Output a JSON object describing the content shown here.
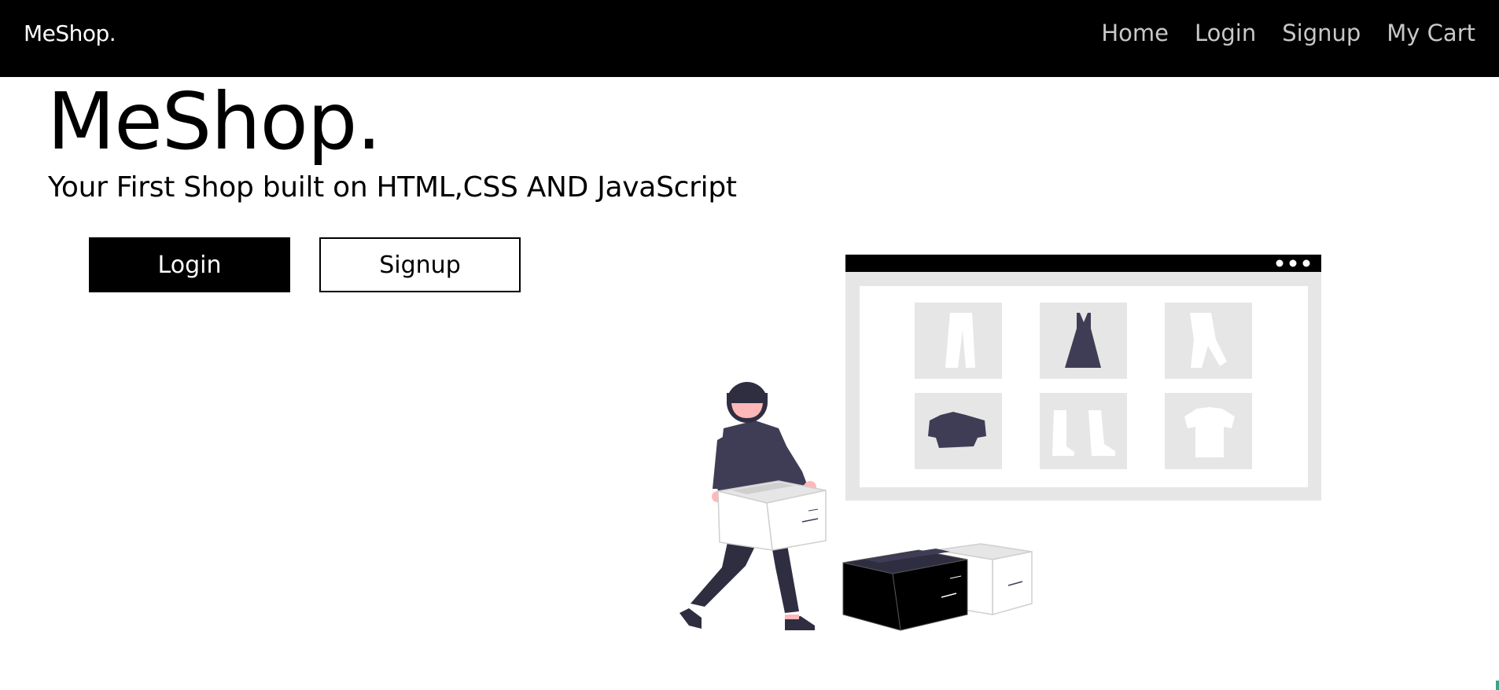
{
  "navbar": {
    "brand": "MeShop.",
    "links": [
      {
        "label": "Home"
      },
      {
        "label": "Login"
      },
      {
        "label": "Signup"
      },
      {
        "label": "My Cart"
      }
    ]
  },
  "hero": {
    "title": "MeShop.",
    "subtitle": "Your First Shop built on HTML,CSS AND JavaScript",
    "login_label": "Login",
    "signup_label": "Signup"
  },
  "illustration": {
    "icons": [
      "pants-icon",
      "dress-icon",
      "trousers-icon",
      "shirt-icon",
      "boots-icon",
      "tshirt-icon"
    ]
  },
  "colors": {
    "nav_background": "#000000",
    "nav_link": "#c8c8c8",
    "accent_dark": "#3f3d56",
    "skin": "#ffb8b8",
    "panel_gray": "#e6e6e6"
  }
}
